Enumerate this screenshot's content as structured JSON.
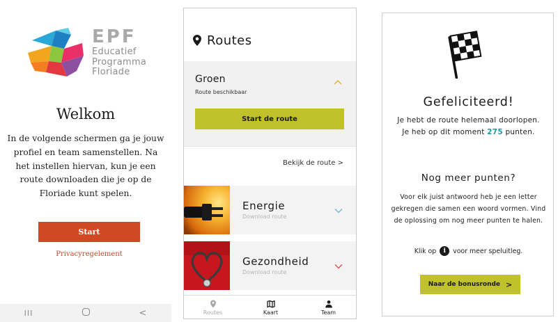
{
  "welcome": {
    "brand": {
      "title": "EPF",
      "line1": "Educatief",
      "line2": "Programma",
      "line3": "Floriade"
    },
    "title": "Welkom",
    "body": "In de volgende schermen ga je jouw profiel en team samenstellen. Na het instellen hiervan, kun je een route downloaden die je op de Floriade kunt spelen.",
    "start_label": "Start",
    "privacy_label": "Privacyregelement",
    "nav": {
      "recents": "III",
      "back": "<"
    },
    "colors": {
      "primary": "#cf4a24"
    }
  },
  "routes": {
    "title": "Routes",
    "groen": {
      "name": "Groen",
      "status": "Route beschikbaar",
      "start_label": "Start de route",
      "view_label": "Bekijk de route >"
    },
    "cards": [
      {
        "title": "Energie",
        "sub": "Download route"
      },
      {
        "title": "Gezondheid",
        "sub": "Download route"
      }
    ],
    "tabs": [
      {
        "label": "Routes",
        "icon": "pin-icon"
      },
      {
        "label": "Kaart",
        "icon": "map-icon"
      },
      {
        "label": "Team",
        "icon": "person-icon"
      }
    ],
    "colors": {
      "accent": "#c1c12b",
      "chevron_open": "#d6b634",
      "chevron_blue": "#7ab6d6",
      "chevron_red": "#d9534f"
    }
  },
  "congrats": {
    "title": "Gefeliciteerd!",
    "text_before": "Je hebt de route helemaal doorlopen. Je heb op dit moment",
    "points": "275",
    "text_after": "punten.",
    "more_title": "Nog meer punten?",
    "more_text": "Voor elk juist antwoord heb je een letter gekregen die samen een woord vormen. Vind de oplossing om nog meer punten te halen.",
    "klik_before": "Klik op",
    "klik_after": "voor meer speluitleg.",
    "bonus_label": "Naar de bonusronde",
    "bonus_chevron": ">",
    "colors": {
      "points": "#1a9aa0",
      "accent": "#c1c12b"
    }
  }
}
